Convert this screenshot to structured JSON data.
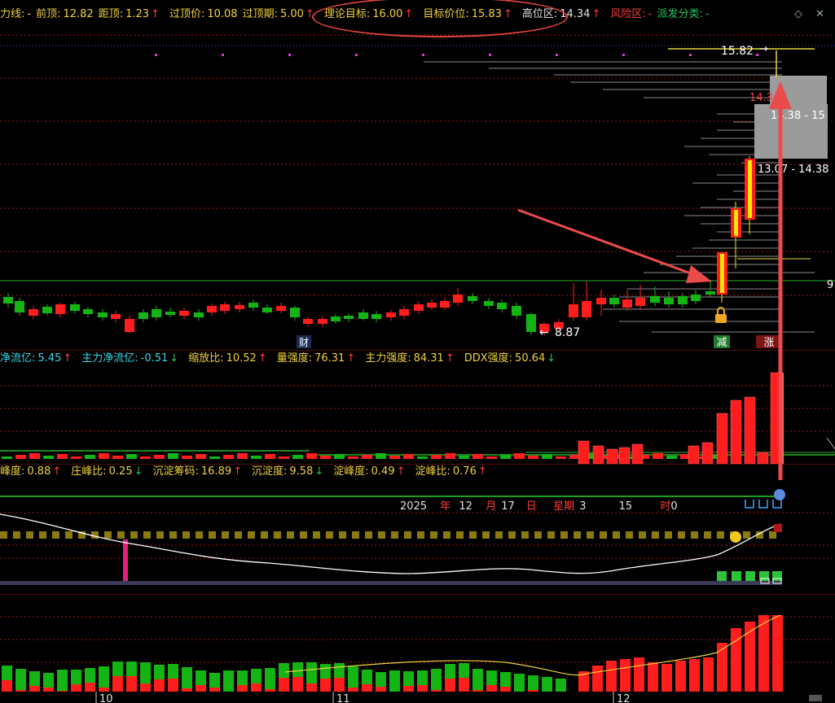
{
  "main_header": {
    "items": [
      {
        "label": "力线:",
        "value": "-",
        "cls": "y"
      },
      {
        "label": "前顶:",
        "value": "12.82",
        "cls": "y"
      },
      {
        "label": "距顶:",
        "value": "1.23",
        "cls": "y",
        "arrow": "↑"
      },
      {
        "label": "过顶价:",
        "value": "10.08",
        "cls": "y"
      },
      {
        "label": "过顶期:",
        "value": "5.00",
        "cls": "y",
        "arrow": "↑"
      },
      {
        "label": "理论目标:",
        "value": "16.00",
        "cls": "y",
        "arrow": "↑"
      },
      {
        "label": "目标价位:",
        "value": "15.83",
        "cls": "y",
        "arrow": "↑"
      },
      {
        "label": "高位区:",
        "value": "14.34",
        "cls": "w",
        "arrow": "↑"
      },
      {
        "label": "风险区:",
        "value": "-",
        "cls": "r"
      },
      {
        "label": "派发分类:",
        "value": "-",
        "cls": "g"
      }
    ],
    "controls": [
      "◇",
      "✕"
    ]
  },
  "price_chart": {
    "target_label": "15.82",
    "zone_high_value": "14.34",
    "zone_range_1": "14.38 - 15",
    "zone_range_2": "13.07 - 14.38",
    "low_label": "8.87",
    "right_edge_label": "9",
    "markers": [
      "财",
      "减",
      "涨"
    ],
    "colors": {
      "up": "#ff1e1e",
      "down": "#14b414",
      "limit_up_fill": "#ffe600",
      "arrow": "#ea4b4b"
    }
  },
  "flow_header": {
    "items": [
      {
        "label": "净流亿:",
        "value": "5.45",
        "arrow": "↑",
        "cls": "c"
      },
      {
        "label": "主力净流亿:",
        "value": "-0.51",
        "arrow": "↓",
        "cls": "c"
      },
      {
        "label": "缩放比:",
        "value": "10.52",
        "arrow": "↑",
        "cls": "y"
      },
      {
        "label": "量强度:",
        "value": "76.31",
        "arrow": "↑",
        "cls": "y"
      },
      {
        "label": "主力强度:",
        "value": "84.31",
        "arrow": "↑",
        "cls": "y"
      },
      {
        "label": "DDX强度:",
        "value": "50.64",
        "arrow": "↓",
        "cls": "y"
      }
    ]
  },
  "peak_header": {
    "items": [
      {
        "label": "峰度:",
        "value": "0.88",
        "arrow": "↑",
        "cls": "y"
      },
      {
        "label": "庄峰比:",
        "value": "0.25",
        "arrow": "↓",
        "cls": "y"
      },
      {
        "label": "沉淀筹码:",
        "value": "16.89",
        "arrow": "↑",
        "cls": "y"
      },
      {
        "label": "沉淀度:",
        "value": "9.58",
        "arrow": "↓",
        "cls": "y"
      },
      {
        "label": "淀峰度:",
        "value": "0.49",
        "arrow": "↑",
        "cls": "y"
      },
      {
        "label": "淀峰比:",
        "value": "0.76",
        "arrow": "↑",
        "cls": "y"
      }
    ],
    "date": {
      "year": "2025",
      "year_unit": "年",
      "month": "12",
      "month_unit": "月",
      "day": "17",
      "day_unit": "日",
      "week_label": "星期",
      "week": "3",
      "hour": "15",
      "hour_unit": "时",
      "minute": "0"
    }
  },
  "time_axis": {
    "labels": [
      "10",
      "11",
      "12"
    ]
  }
}
